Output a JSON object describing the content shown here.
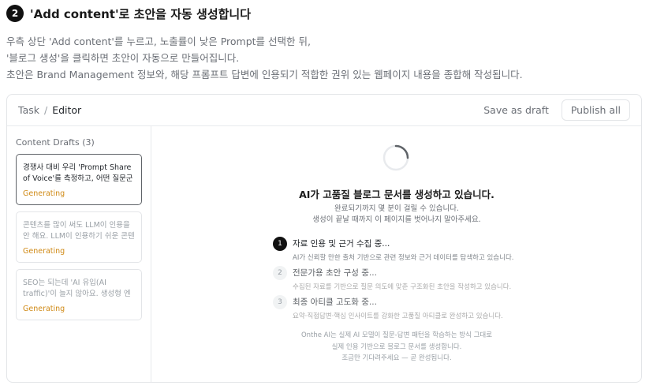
{
  "header": {
    "step_number": "2",
    "title": "'Add content'로 초안을 자동 생성합니다"
  },
  "description": {
    "line1": "우측 상단 'Add content'를 누르고, 노출률이 낮은 Prompt를 선택한 뒤,",
    "line2": "'블로그 생성'을 클릭하면 초안이 자동으로 만들어집니다.",
    "line3": "초안은 Brand Management 정보와, 해당 프롬프트 답변에 인용되기 적합한 권위 있는 웹페이지 내용을 종합해 작성됩니다."
  },
  "editor": {
    "breadcrumb": {
      "task": "Task",
      "separator": "/",
      "current": "Editor"
    },
    "save_draft_label": "Save as draft",
    "publish_label": "Publish all"
  },
  "sidebar": {
    "title": "Content Drafts (3)",
    "drafts": [
      {
        "text": "경쟁사 대비 우리 'Prompt Share of Voice'를 측정하고, 어떤 질문군에서...",
        "status": "Generating"
      },
      {
        "text": "콘텐츠를 많이 써도 LLM이 인용을 안 해요. LLM이 인용하기 쉬운 콘텐츠 ...",
        "status": "Generating"
      },
      {
        "text": "SEO는 되는데 'AI 유입(AI traffic)'이 늘지 않아요. 생성형 엔진 유입을 분리...",
        "status": "Generating"
      }
    ]
  },
  "generation": {
    "title": "AI가 고품질 블로그 문서를 생성하고 있습니다.",
    "sub1": "완료되기까지 몇 분이 걸릴 수 있습니다.",
    "sub2": "생성이 끝날 때까지 이 페이지를 벗어나지 말아주세요.",
    "steps": [
      {
        "num": "1",
        "name": "자료 인용 및 근거 수집 중...",
        "desc": "AI가 신뢰할 만한 출처 기반으로 관련 정보와 근거 데이터를 탐색하고 있습니다."
      },
      {
        "num": "2",
        "name": "전문가용 초안 구성 중...",
        "desc": "수집된 자료를 기반으로 질문 의도에 맞춘 구조화된 초안을 작성하고 있습니다."
      },
      {
        "num": "3",
        "name": "최종 아티클 고도화 중...",
        "desc": "요약·직접답변·핵심 인사이트를 강화한 고품질 아티클로 완성하고 있습니다."
      }
    ],
    "footer1": "Onthe AI는 실제 AI 모델이 질문-답변 패턴을 학습하는 방식 그대로",
    "footer2": "실제 인용 기반으로 블로그 문서를 생성합니다.",
    "footer3": "조금만 기다려주세요 — 곧 완성됩니다."
  },
  "icons": {
    "spinner": "loading-spinner-icon"
  },
  "colors": {
    "accent": "#111111",
    "generating": "#d08a16"
  }
}
